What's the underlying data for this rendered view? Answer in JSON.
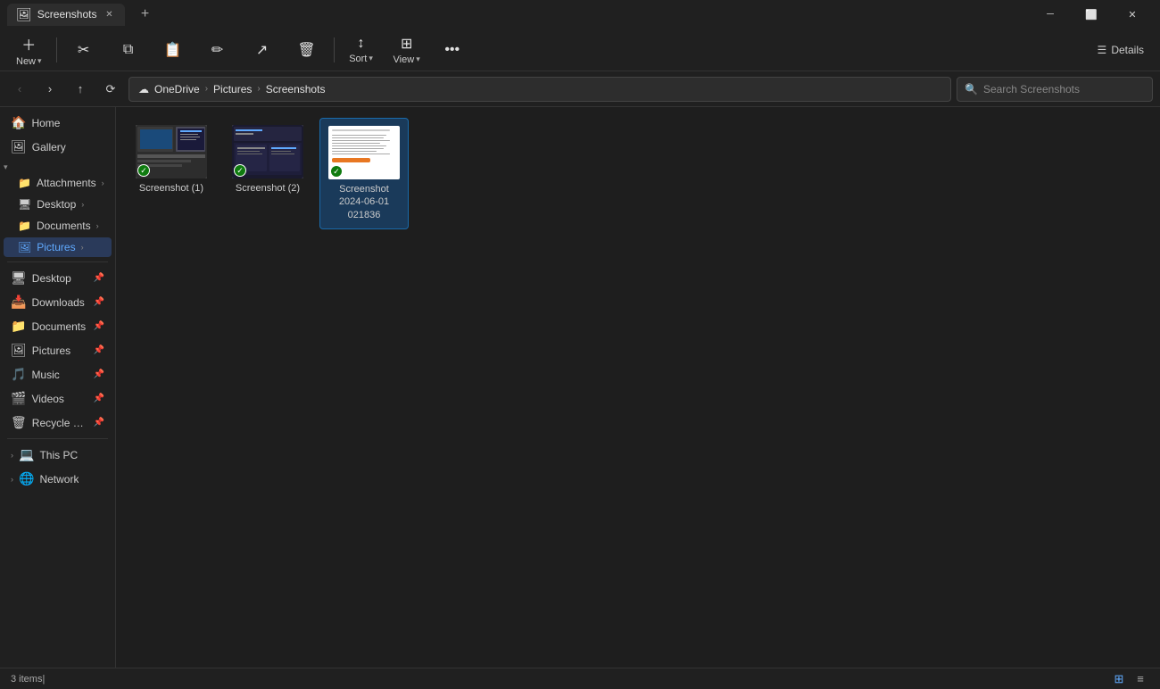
{
  "titleBar": {
    "tabIcon": "🖼",
    "tabLabel": "Screenshots",
    "tabClose": "✕",
    "newTab": "+",
    "btnMinimize": "─",
    "btnMaximize": "⬜",
    "btnClose": "✕"
  },
  "toolbar": {
    "newLabel": "New",
    "cutIcon": "✂",
    "copyIcon": "⧉",
    "pasteIcon": "📋",
    "renameIcon": "✏",
    "shareIcon": "↗",
    "deleteIcon": "🗑",
    "sortLabel": "Sort",
    "viewLabel": "View",
    "moreLabel": "•••",
    "detailsLabel": "Details",
    "detailsIcon": "📄"
  },
  "addressBar": {
    "navBack": "‹",
    "navForward": "›",
    "navUp": "↑",
    "navRefresh": "⟳",
    "breadcrumbs": [
      {
        "label": "OneDrive",
        "icon": "☁"
      },
      {
        "sep": "›"
      },
      {
        "label": "Pictures"
      },
      {
        "sep": "›"
      },
      {
        "label": "Screenshots"
      }
    ],
    "searchPlaceholder": "Search Screenshots",
    "searchIcon": "🔍"
  },
  "sidebar": {
    "items": [
      {
        "id": "home",
        "icon": "🏠",
        "label": "Home"
      },
      {
        "id": "gallery",
        "icon": "🖼",
        "label": "Gallery"
      },
      {
        "id": "attachments",
        "icon": "📁",
        "label": "Attachments",
        "arrow": true,
        "indent": true
      },
      {
        "id": "desktop",
        "icon": "🖥",
        "label": "Desktop",
        "arrow": true,
        "indent": true
      },
      {
        "id": "documents",
        "icon": "📁",
        "label": "Documents",
        "arrow": true,
        "indent": true
      },
      {
        "id": "pictures",
        "icon": "🖼",
        "label": "Pictures",
        "arrow": true,
        "indent": true,
        "active": true
      },
      {
        "divider": true
      },
      {
        "id": "desktop2",
        "icon": "🖥",
        "label": "Desktop",
        "pin": true
      },
      {
        "id": "downloads",
        "icon": "📥",
        "label": "Downloads",
        "pin": true
      },
      {
        "id": "documents2",
        "icon": "📁",
        "label": "Documents",
        "pin": true
      },
      {
        "id": "pictures2",
        "icon": "🖼",
        "label": "Pictures",
        "pin": true
      },
      {
        "id": "music",
        "icon": "🎵",
        "label": "Music",
        "pin": true
      },
      {
        "id": "videos",
        "icon": "🎬",
        "label": "Videos",
        "pin": true
      },
      {
        "id": "recyclebin",
        "icon": "🗑",
        "label": "Recycle Bin",
        "pin": true
      },
      {
        "divider": true
      },
      {
        "id": "thispc",
        "icon": "💻",
        "label": "This PC",
        "arrow": true
      },
      {
        "id": "network",
        "icon": "🌐",
        "label": "Network",
        "arrow": true
      }
    ]
  },
  "files": [
    {
      "id": "screenshot1",
      "name": "Screenshot (1)",
      "type": "thumb1",
      "synced": true
    },
    {
      "id": "screenshot2",
      "name": "Screenshot (2)",
      "type": "thumb2",
      "synced": true
    },
    {
      "id": "screenshot3",
      "name": "Screenshot 2024-06-01 021836",
      "type": "doc",
      "synced": true,
      "selected": true
    }
  ],
  "statusBar": {
    "itemCount": "3 items",
    "cursor": "|",
    "viewGrid": "⊞",
    "viewList": "≡"
  }
}
